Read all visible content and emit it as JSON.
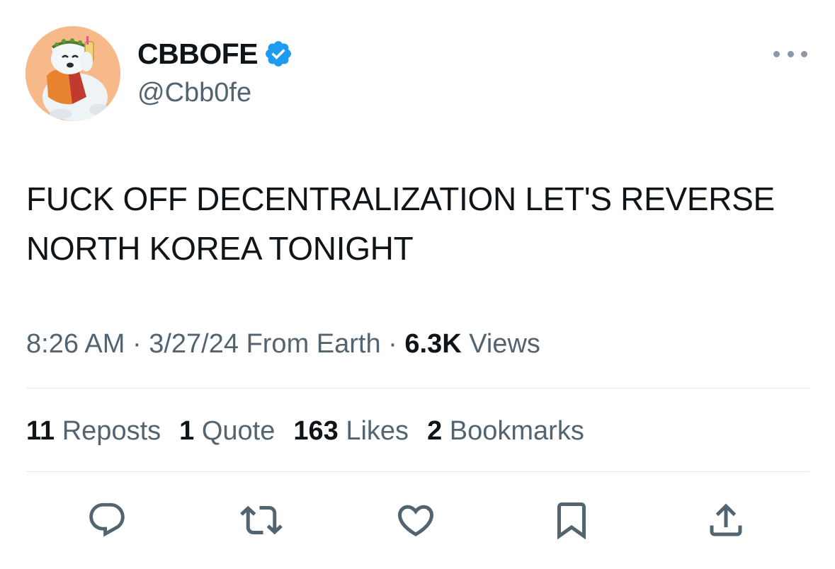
{
  "author": {
    "display_name": "CBBOFE",
    "handle": "@Cbb0fe",
    "verified_icon": "verified-badge-icon",
    "avatar_icon": "polar-bear-avatar"
  },
  "tweet": {
    "text": "FUCK OFF DECENTRALIZATION LET'S REVERSE NORTH KOREA TONIGHT"
  },
  "meta": {
    "time": "8:26 AM",
    "separator": "·",
    "date": "3/27/24",
    "source": "From Earth",
    "views_count": "6.3K",
    "views_label": "Views"
  },
  "stats": {
    "reposts_count": "11",
    "reposts_label": "Reposts",
    "quotes_count": "1",
    "quotes_label": "Quote",
    "likes_count": "163",
    "likes_label": "Likes",
    "bookmarks_count": "2",
    "bookmarks_label": "Bookmarks"
  },
  "actions": [
    {
      "icon": "reply-icon"
    },
    {
      "icon": "repost-icon"
    },
    {
      "icon": "like-icon"
    },
    {
      "icon": "bookmark-icon"
    },
    {
      "icon": "share-icon"
    }
  ],
  "colors": {
    "text_primary": "#0f1419",
    "text_secondary": "#536471",
    "verified_blue": "#1d9bf0",
    "divider": "#e1e8ed",
    "avatar_bg": "#f7b98a"
  }
}
